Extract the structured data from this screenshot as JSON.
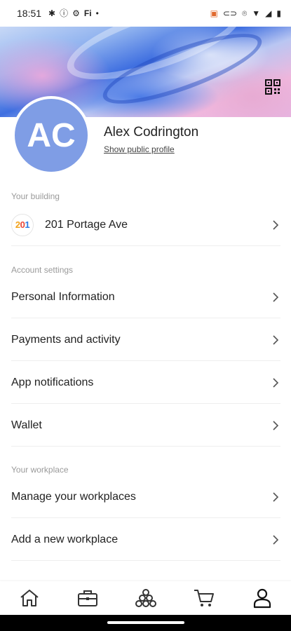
{
  "status_bar": {
    "time": "18:51",
    "left_icons": [
      "gear-icon",
      "info-icon",
      "settings-circle-icon",
      "fi-icon",
      "dot-icon"
    ],
    "right_icons": [
      "cast-icon",
      "caps-icon",
      "location-icon",
      "wifi-icon",
      "signal-icon",
      "battery-icon"
    ]
  },
  "profile": {
    "initials": "AC",
    "name": "Alex Codrington",
    "public_link": "Show public profile",
    "avatar_color": "#7f9de5"
  },
  "building_section": {
    "label": "Your building",
    "building_name": "201 Portage Ave",
    "logo_text": [
      "2",
      "0",
      "1"
    ]
  },
  "account_section": {
    "label": "Account settings",
    "items": [
      {
        "label": "Personal Information"
      },
      {
        "label": "Payments and activity"
      },
      {
        "label": "App notifications"
      },
      {
        "label": "Wallet"
      }
    ]
  },
  "workplace_section": {
    "label": "Your workplace",
    "items": [
      {
        "label": "Manage your workplaces"
      },
      {
        "label": "Add a new workplace"
      }
    ]
  },
  "bottom_nav": {
    "items": [
      "home-icon",
      "briefcase-icon",
      "community-icon",
      "cart-icon",
      "profile-icon"
    ],
    "active": "profile-icon"
  },
  "colors": {
    "accent": "#7f9de5",
    "text": "#222222",
    "muted": "#9a9a9a",
    "divider": "#eeeeee"
  }
}
